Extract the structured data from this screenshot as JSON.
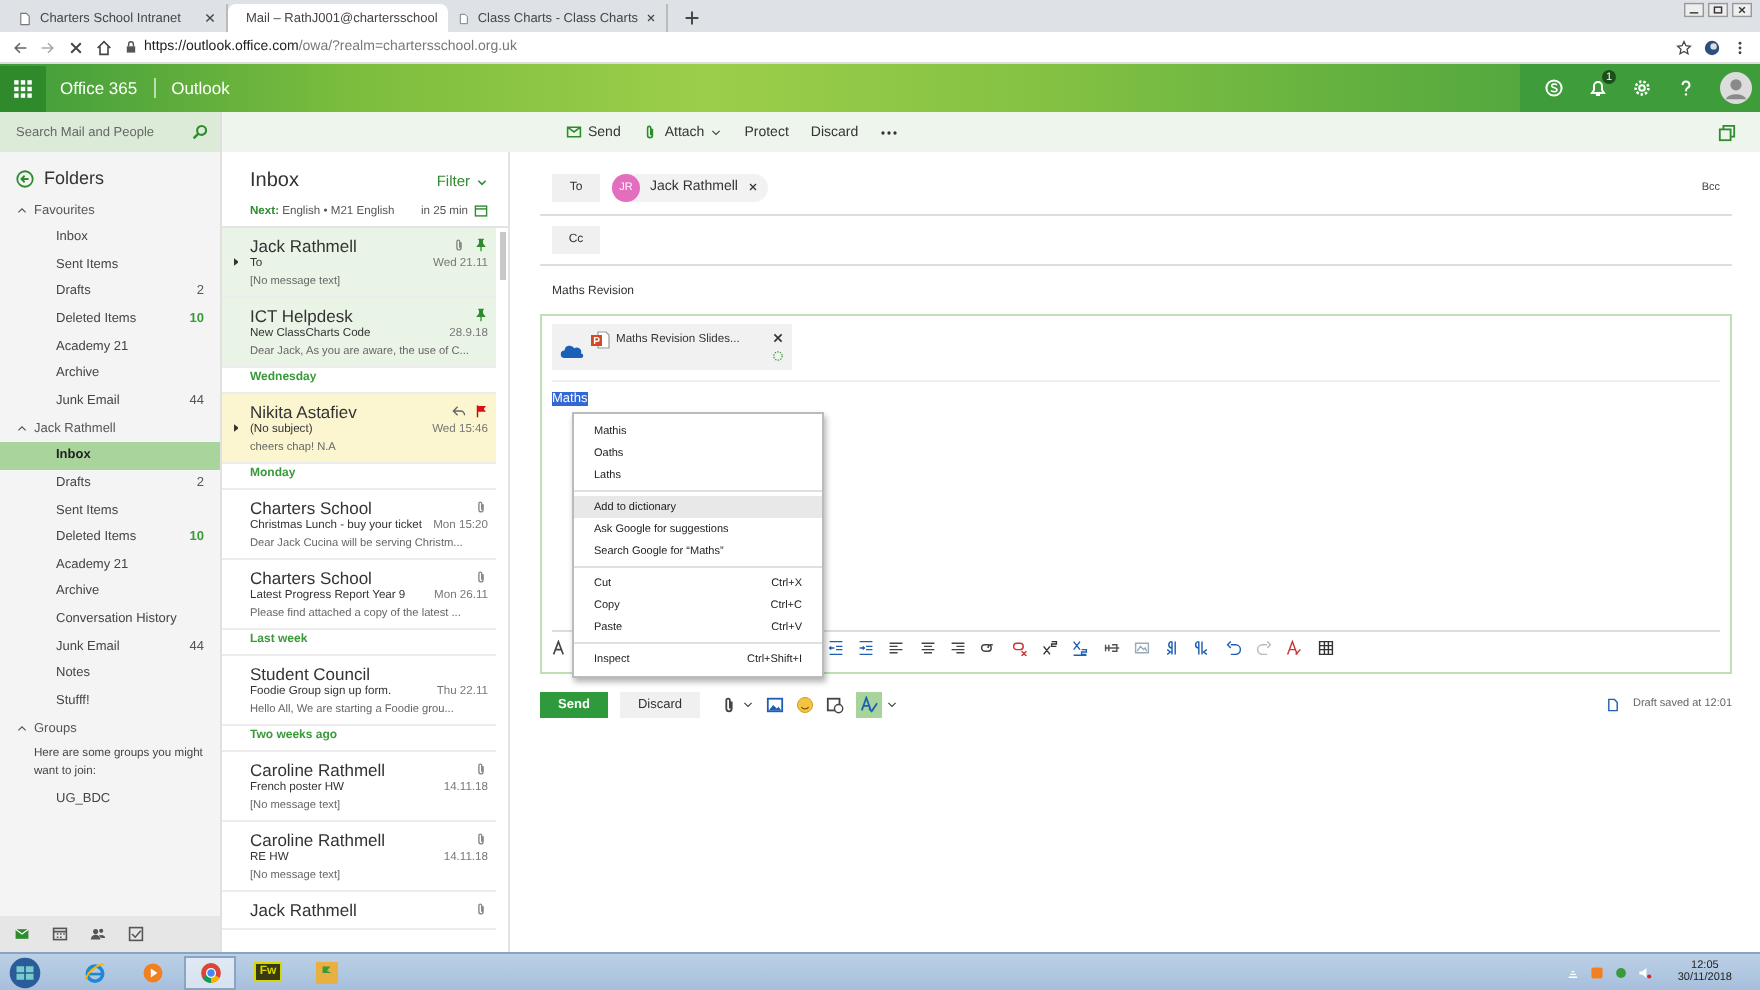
{
  "browser": {
    "tabs": [
      {
        "title": "Charters School Intranet",
        "selected": false
      },
      {
        "title": "Mail – RathJ001@chartersschool",
        "selected": true
      },
      {
        "title": "Class Charts - Class Charts",
        "selected": false
      }
    ],
    "url_host": "https://outlook.office.com",
    "url_path": "/owa/?realm=chartersschool.org.uk"
  },
  "header": {
    "suite": "Office 365",
    "app": "Outlook",
    "notification_count": "1"
  },
  "sidebar": {
    "search_placeholder": "Search Mail and People",
    "folders_title": "Folders",
    "groups": [
      {
        "name": "Favourites",
        "expanded": true,
        "children": [
          {
            "name": "Inbox",
            "selected": false
          },
          {
            "name": "Sent Items",
            "selected": false
          },
          {
            "name": "Drafts",
            "count": "2",
            "unread": false,
            "selected": false
          },
          {
            "name": "Deleted Items",
            "count": "10",
            "unread": true,
            "selected": false
          },
          {
            "name": "Academy 21",
            "selected": false
          },
          {
            "name": "Archive",
            "selected": false
          },
          {
            "name": "Junk Email",
            "count": "44",
            "unread": false,
            "selected": false
          }
        ]
      },
      {
        "name": "Jack Rathmell",
        "expanded": true,
        "children": [
          {
            "name": "Inbox",
            "selected": true
          },
          {
            "name": "Drafts",
            "count": "2",
            "unread": false,
            "selected": false
          },
          {
            "name": "Sent Items",
            "selected": false
          },
          {
            "name": "Deleted Items",
            "count": "10",
            "unread": true,
            "selected": false
          },
          {
            "name": "Academy 21",
            "selected": false
          },
          {
            "name": "Archive",
            "selected": false
          },
          {
            "name": "Conversation History",
            "selected": false
          },
          {
            "name": "Junk Email",
            "count": "44",
            "unread": false,
            "selected": false
          },
          {
            "name": "Notes",
            "selected": false
          },
          {
            "name": "Stufff!",
            "selected": false
          }
        ]
      }
    ],
    "groups_section": {
      "name": "Groups",
      "expanded": true,
      "hint": "Here are some groups you might want to join:",
      "items": [
        "UG_BDC"
      ]
    },
    "nav": [
      {
        "kind": "mail",
        "selected": true
      },
      {
        "kind": "calendar",
        "selected": false
      },
      {
        "kind": "people",
        "selected": false
      },
      {
        "kind": "tasks",
        "selected": false
      }
    ]
  },
  "commands": [
    {
      "kind": "send",
      "label": "Send"
    },
    {
      "kind": "attach",
      "label": "Attach"
    },
    {
      "kind": "plain",
      "label": "Protect"
    },
    {
      "kind": "plain",
      "label": "Discard"
    },
    {
      "kind": "more"
    }
  ],
  "inbox": {
    "title": "Inbox",
    "filter": "Filter",
    "next_event": "**Next:** English • M21 English",
    "next_time": "in 25 min",
    "items": [
      {
        "kind": "message",
        "sender": "Jack Rathmell",
        "subject": "To",
        "date": "Wed 21.11",
        "preview": "[No message text]",
        "pinned": true,
        "flagged": false,
        "attachment": true,
        "replied": false,
        "expand": true
      },
      {
        "kind": "message",
        "sender": "ICT Helpdesk",
        "subject": "New ClassCharts Code",
        "date": "28.9.18",
        "preview": "Dear Jack, As you are aware, the use of C...",
        "pinned": true,
        "flagged": false,
        "attachment": false,
        "replied": false,
        "expand": false
      },
      {
        "kind": "heading",
        "label": "Wednesday"
      },
      {
        "kind": "message",
        "sender": "Nikita Astafiev",
        "subject": "(No subject)",
        "date": "Wed 15:46",
        "preview": "cheers chap!  N.A",
        "pinned": false,
        "flagged": true,
        "attachment": false,
        "replied": true,
        "expand": true
      },
      {
        "kind": "heading",
        "label": "Monday"
      },
      {
        "kind": "message",
        "sender": "Charters School",
        "subject": "Christmas Lunch - buy your ticket",
        "date": "Mon 15:20",
        "preview": "Dear Jack  Cucina will be serving Christm...",
        "pinned": false,
        "flagged": false,
        "attachment": true,
        "replied": false,
        "expand": false
      },
      {
        "kind": "message",
        "sender": "Charters School",
        "subject": "Latest Progress Report Year 9",
        "date": "Mon 26.11",
        "preview": "Please find attached a copy of the latest ...",
        "pinned": false,
        "flagged": false,
        "attachment": true,
        "replied": false,
        "expand": false
      },
      {
        "kind": "heading",
        "label": "Last week"
      },
      {
        "kind": "message",
        "sender": "Student Council",
        "subject": "Foodie Group sign up form.",
        "date": "Thu 22.11",
        "preview": "Hello All,   We are starting a Foodie grou...",
        "pinned": false,
        "flagged": false,
        "attachment": false,
        "replied": false,
        "expand": false
      },
      {
        "kind": "heading",
        "label": "Two weeks ago"
      },
      {
        "kind": "message",
        "sender": "Caroline Rathmell",
        "subject": "French poster HW",
        "date": "14.11.18",
        "preview": "[No message text]",
        "pinned": false,
        "flagged": false,
        "attachment": true,
        "replied": false,
        "expand": false
      },
      {
        "kind": "message",
        "sender": "Caroline Rathmell",
        "subject": "RE HW",
        "date": "14.11.18",
        "preview": "[No message text]",
        "pinned": false,
        "flagged": false,
        "attachment": true,
        "replied": false,
        "expand": false
      },
      {
        "kind": "message",
        "sender": "Jack Rathmell",
        "pinned": false,
        "flagged": false,
        "attachment": true,
        "replied": false,
        "expand": false
      }
    ]
  },
  "compose": {
    "to_label": "To",
    "recipients": [
      {
        "initials": "JR",
        "name": "Jack Rathmell"
      }
    ],
    "bcc": "Bcc",
    "cc_label": "Cc",
    "subject": "Maths Revision",
    "attachment": {
      "name": "Maths Revision Slides..."
    },
    "body_text": "Maths",
    "body_selected": true,
    "send": "Send",
    "discard": "Discard",
    "spellcheck_on": true,
    "draft_status": "Draft saved at 12:01"
  },
  "context_menu": {
    "sections": [
      [
        {
          "label": "Mathis",
          "hovered": false
        },
        {
          "label": "Oaths",
          "hovered": false
        },
        {
          "label": "Laths",
          "hovered": false
        }
      ],
      [
        {
          "label": "Add to dictionary",
          "hovered": true
        },
        {
          "label": "Ask Google for suggestions",
          "hovered": false
        },
        {
          "label": "Search Google for “Maths”",
          "hovered": false
        }
      ],
      [
        {
          "label": "Cut",
          "shortcut": "Ctrl+X",
          "hovered": false
        },
        {
          "label": "Copy",
          "shortcut": "Ctrl+C",
          "hovered": false
        },
        {
          "label": "Paste",
          "shortcut": "Ctrl+V",
          "hovered": false
        }
      ],
      [
        {
          "label": "Inspect",
          "shortcut": "Ctrl+Shift+I",
          "hovered": false
        }
      ]
    ]
  },
  "taskbar": {
    "apps": [
      {
        "kind": "ie",
        "active": false
      },
      {
        "kind": "media",
        "active": false
      },
      {
        "kind": "chrome",
        "active": true
      },
      {
        "kind": "fireworks",
        "label": "Fw",
        "active": false
      },
      {
        "kind": "app",
        "active": false
      }
    ],
    "time": "12:05",
    "date": "30/11/2018"
  }
}
